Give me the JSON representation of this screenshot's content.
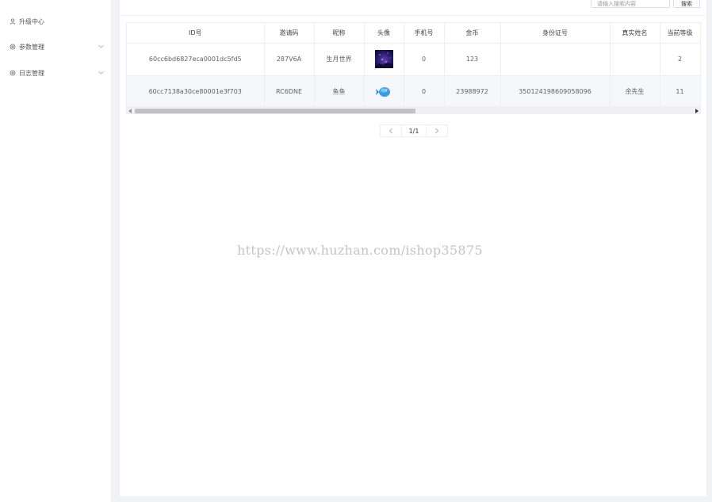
{
  "sidebar": {
    "items": [
      {
        "label": "升级中心",
        "icon": "user-icon"
      },
      {
        "label": "参数管理",
        "icon": "gear-icon"
      },
      {
        "label": "日志管理",
        "icon": "gear-icon"
      }
    ]
  },
  "search": {
    "placeholder": "请输入搜索内容",
    "button_label": "搜索"
  },
  "table": {
    "headers": [
      "ID号",
      "邀请码",
      "昵称",
      "头像",
      "手机号",
      "金币",
      "身份证号",
      "真实姓名",
      "当前等级"
    ],
    "rows": [
      {
        "id": "60cc6bd6827eca0001dc5fd5",
        "invite": "287V6A",
        "nickname": "生月世界",
        "avatar": "avatar-night-sky",
        "phone": "0",
        "coins": "123",
        "idcard": "",
        "realname": "",
        "level": "2"
      },
      {
        "id": "60cc7138a30ce80001e3f703",
        "invite": "RC6DNE",
        "nickname": "鱼鱼",
        "avatar": "avatar-blue-fish",
        "phone": "0",
        "coins": "23988972",
        "idcard": "350124198609058096",
        "realname": "余先生",
        "level": "11"
      }
    ]
  },
  "pagination": {
    "text": "1/1"
  },
  "watermark": "https://www.huzhan.com/ishop35875",
  "colors": {
    "panel_bg": "#ffffff",
    "page_bg": "#f0f2f5",
    "border": "#ebeef5",
    "row_alt": "#f5f7fa"
  }
}
